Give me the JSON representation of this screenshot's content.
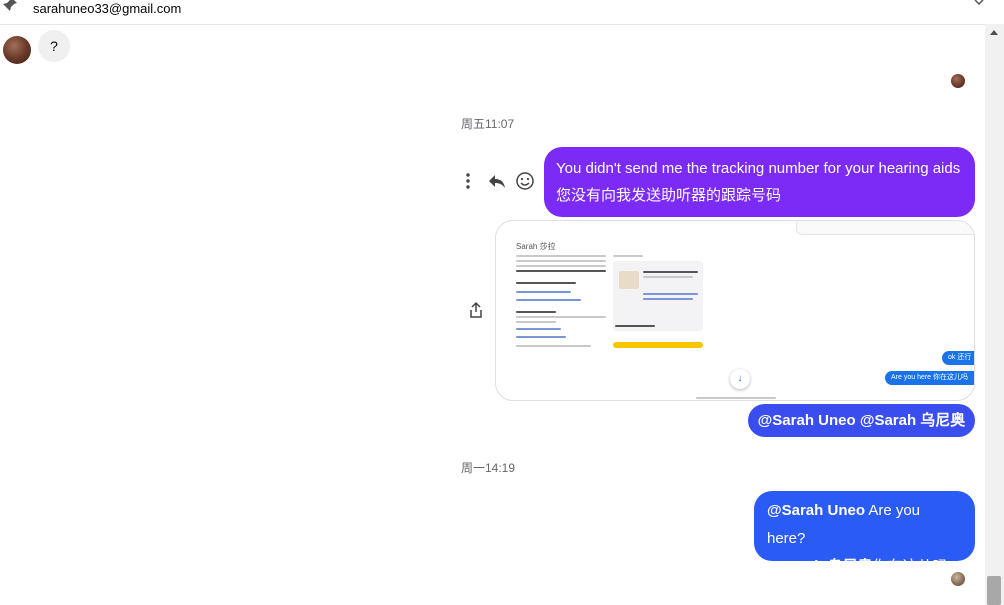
{
  "header": {
    "email": "sarahuneo33@gmail.com"
  },
  "contact": {
    "question_bubble": "?"
  },
  "timestamps": {
    "first": "周五11:07",
    "second": "周一14:19"
  },
  "messages": {
    "msg1_line1": "You didn't send me the tracking number for your hearing aids",
    "msg1_line2": "您没有向我发送助听器的跟踪号码",
    "mention": "@Sarah Uneo  @Sarah 乌尼奥",
    "msg2_mention1": "@Sarah Uneo",
    "msg2_text1": " Are you here?",
    "msg2_mention2": "@Sarah 乌尼奥",
    "msg2_text2": "你在这儿吗?"
  },
  "preview": {
    "sender": "Sarah  莎拉",
    "chip1": "ok  还行",
    "chip2": "Are you here  你在这儿吗"
  },
  "colors": {
    "purple_bubble": "#7b2bf5",
    "blue_bubble": "#2b5bf5",
    "mention_bubble": "#3a4ef0",
    "timestamp": "#65676b"
  },
  "icons": [
    "pin-icon",
    "chevron-down-icon",
    "more-vertical-icon",
    "reply-icon",
    "emoji-icon",
    "share-icon",
    "scroll-down-icon"
  ]
}
